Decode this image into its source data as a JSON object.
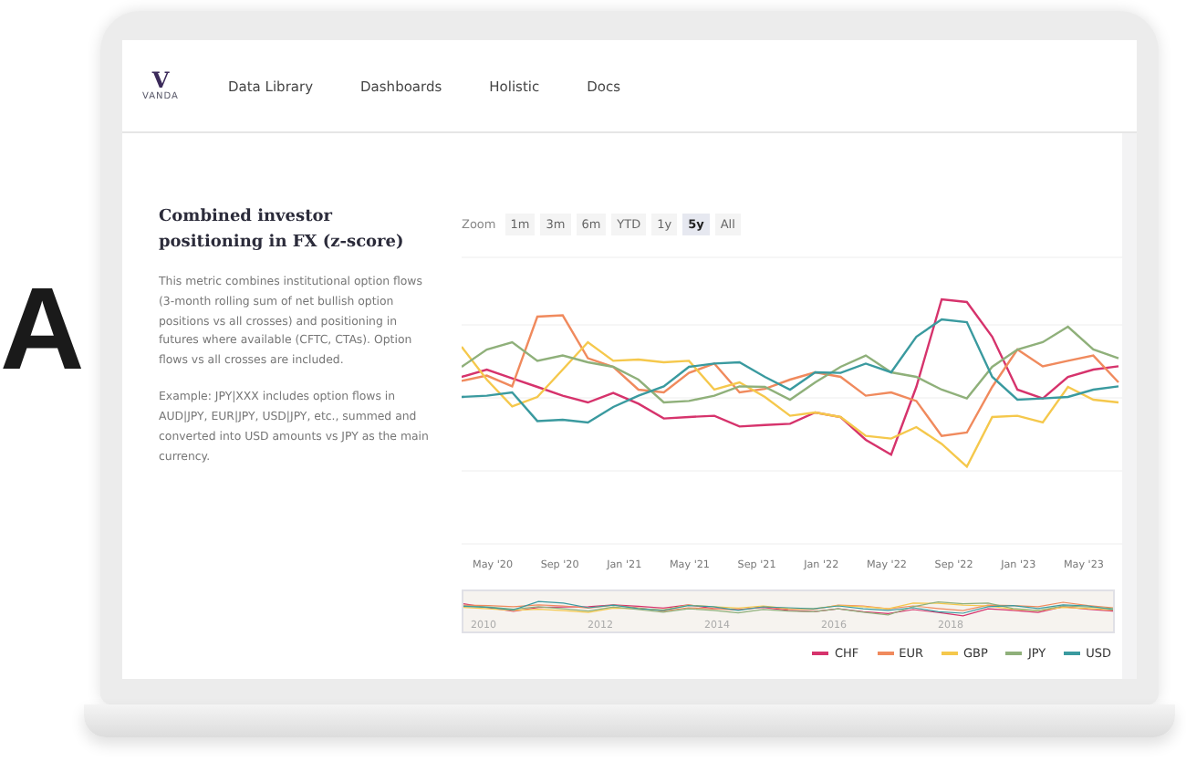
{
  "side_letter": "A",
  "nav": {
    "logo_mark": "V",
    "logo_text": "VANDA",
    "items": [
      "Data Library",
      "Dashboards",
      "Holistic",
      "Docs"
    ]
  },
  "article": {
    "title": "Combined investor positioning in FX (z-score)",
    "paragraphs": [
      "This metric combines institutional option flows (3-month rolling sum of net bullish option positions vs all crosses) and positioning in futures where available (CFTC, CTAs). Option flows vs all crosses are included.",
      "Example: JPY|XXX includes option flows in AUD|JPY, EUR|JPY, USD|JPY, etc., summed and converted into USD amounts vs JPY as the main currency."
    ]
  },
  "zoom": {
    "label": "Zoom",
    "buttons": [
      {
        "label": "1m",
        "selected": false
      },
      {
        "label": "3m",
        "selected": false
      },
      {
        "label": "6m",
        "selected": false
      },
      {
        "label": "YTD",
        "selected": false
      },
      {
        "label": "1y",
        "selected": false
      },
      {
        "label": "5y",
        "selected": true
      },
      {
        "label": "All",
        "selected": false
      }
    ]
  },
  "x_labels": [
    "May '20",
    "Sep '20",
    "Jan '21",
    "May '21",
    "Sep '21",
    "Jan '22",
    "May '22",
    "Sep '22",
    "Jan '23",
    "May '23"
  ],
  "navigator_labels": [
    "2010",
    "2012",
    "2014",
    "2016",
    "2018"
  ],
  "legend": [
    {
      "name": "CHF",
      "color": "#d6336c"
    },
    {
      "name": "EUR",
      "color": "#f08a5d"
    },
    {
      "name": "GBP",
      "color": "#f5c84c"
    },
    {
      "name": "JPY",
      "color": "#8fb07a"
    },
    {
      "name": "USD",
      "color": "#3a9a9f"
    }
  ]
}
